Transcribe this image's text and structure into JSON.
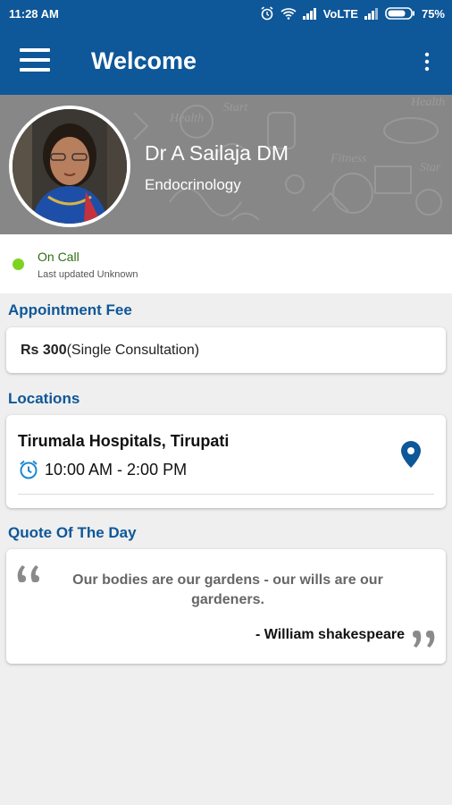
{
  "status_bar": {
    "time": "11:28 AM",
    "network": "VoLTE",
    "battery": "75%",
    "icons": [
      "alarm-icon",
      "wifi-icon",
      "signal-icon",
      "signal-icon",
      "battery-icon"
    ]
  },
  "app_bar": {
    "title": "Welcome",
    "menu_icon": "hamburger-menu-icon",
    "overflow_icon": "more-vertical-icon"
  },
  "profile": {
    "name": "Dr A Sailaja DM",
    "specialty": "Endocrinology"
  },
  "availability": {
    "status": "On Call",
    "last_updated": "Last updated Unknown",
    "status_color": "#7ed321"
  },
  "fee": {
    "heading": "Appointment Fee",
    "amount": "Rs 300",
    "detail": "(Single Consultation)"
  },
  "locations": {
    "heading": "Locations",
    "items": [
      {
        "name": "Tirumala Hospitals, Tirupati",
        "timing": "10:00 AM - 2:00 PM"
      }
    ]
  },
  "quote": {
    "heading": "Quote Of The Day",
    "text": "Our bodies are our gardens - our wills are our gardeners.",
    "author": "- William shakespeare"
  },
  "colors": {
    "primary": "#0e5798",
    "on_call": "#7ed321",
    "background": "#efefef"
  }
}
